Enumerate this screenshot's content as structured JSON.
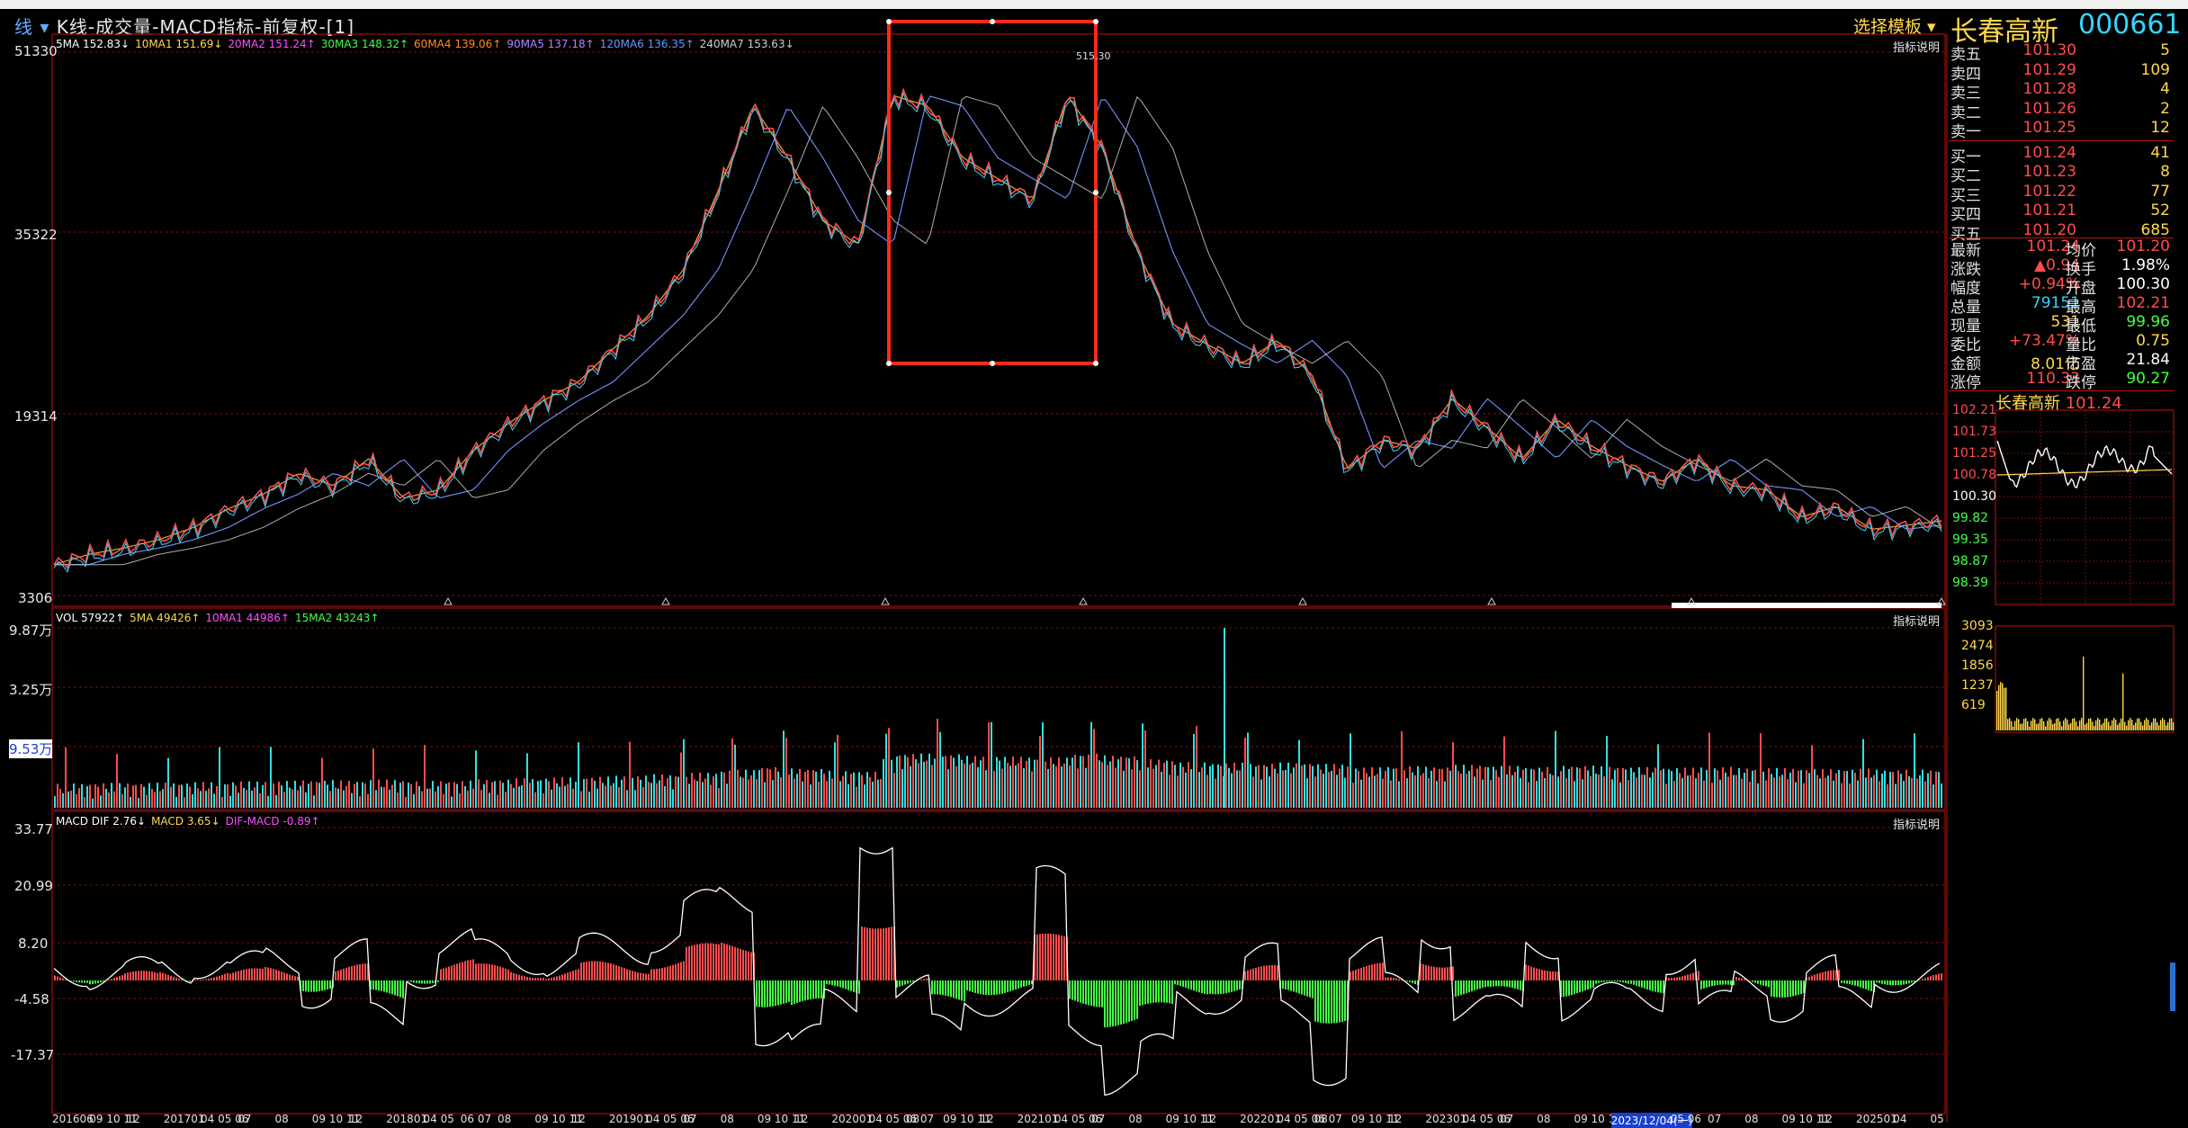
{
  "header": {
    "title_prefix": "线",
    "title": "K线-成交量-MACD指标-前复权-[1]",
    "template_button": "选择模板",
    "stock_name": "长春高新",
    "stock_code": "000661"
  },
  "ma_legend": [
    {
      "text": "5MA 152.83↓",
      "color": "#ffffff"
    },
    {
      "text": "10MA1 151.69↓",
      "color": "#ffd84a"
    },
    {
      "text": "20MA2 151.24↑",
      "color": "#ff4dff"
    },
    {
      "text": "30MA3 148.32↑",
      "color": "#44ff44"
    },
    {
      "text": "60MA4 139.06↑",
      "color": "#ff8c1a"
    },
    {
      "text": "90MA5 137.18↑",
      "color": "#aa88ff"
    },
    {
      "text": "120MA6 136.35↑",
      "color": "#6699ff"
    },
    {
      "text": "240MA7 153.63↓",
      "color": "#cccccc"
    }
  ],
  "vol_legend": [
    {
      "text": "VOL 57922↑",
      "color": "#ffffff"
    },
    {
      "text": "5MA 49426↑",
      "color": "#ffd84a"
    },
    {
      "text": "10MA1 44986↑",
      "color": "#ff4dff"
    },
    {
      "text": "15MA2 43243↑",
      "color": "#44ff44"
    }
  ],
  "macd_legend": [
    {
      "text": "MACD DIF 2.76↓",
      "color": "#ffffff"
    },
    {
      "text": "MACD 3.65↓",
      "color": "#ffd84a"
    },
    {
      "text": "DIF-MACD -0.89↑",
      "color": "#ff4dff"
    }
  ],
  "indicator_label": "指标说明",
  "peak_label": "515.30",
  "price_axis": [
    "51330",
    "35322",
    "19314",
    "3306"
  ],
  "vol_axis": [
    "9.87万",
    "3.25万",
    "9.53万"
  ],
  "macd_axis": [
    "33.77",
    "20.99",
    "8.20",
    "-4.58",
    "-17.37"
  ],
  "date_axis": [
    "201606",
    "09 10 11",
    "12",
    "201701",
    "04 05 06",
    "07",
    "08",
    "09 10 11",
    "12",
    "201801",
    "04 05",
    "06 07",
    "08",
    "09 10 11",
    "12",
    "201901",
    "04 05 06",
    "07",
    "08",
    "09 10 11",
    "12",
    "202001",
    "04 05 06 07",
    "08",
    "09 10 11",
    "12",
    "202101",
    "04 05 06",
    "07",
    "08",
    "09 10 11",
    "12",
    "202201",
    "04 05 06 07",
    "08",
    "09 10 11",
    "12",
    "202301",
    "04 05 06",
    "07",
    "08",
    "09 10 11"
  ],
  "date_cursor": "2023/12/04(一)",
  "date_axis_tail": [
    "05 06",
    "07",
    "08",
    "09 10 11",
    "12",
    "202501",
    "04",
    "05"
  ],
  "order_book": {
    "asks": [
      {
        "label": "卖五",
        "price": "101.30",
        "vol": "5"
      },
      {
        "label": "卖四",
        "price": "101.29",
        "vol": "109"
      },
      {
        "label": "卖三",
        "price": "101.28",
        "vol": "4"
      },
      {
        "label": "卖二",
        "price": "101.26",
        "vol": "2"
      },
      {
        "label": "卖一",
        "price": "101.25",
        "vol": "12"
      }
    ],
    "bids": [
      {
        "label": "买一",
        "price": "101.24",
        "vol": "41"
      },
      {
        "label": "买二",
        "price": "101.23",
        "vol": "8"
      },
      {
        "label": "买三",
        "price": "101.22",
        "vol": "77"
      },
      {
        "label": "买四",
        "price": "101.21",
        "vol": "52"
      },
      {
        "label": "买五",
        "price": "101.20",
        "vol": "685"
      }
    ]
  },
  "stats": [
    {
      "l1": "最新",
      "v1": "101.24",
      "c1": "#ff4d4d",
      "l2": "均价",
      "v2": "101.20",
      "c2": "#ff4d4d"
    },
    {
      "l1": "涨跌",
      "v1": "▲0.94",
      "c1": "#ff4d4d",
      "l2": "换手",
      "v2": "1.98%",
      "c2": "#ffffff"
    },
    {
      "l1": "幅度",
      "v1": "+0.94%",
      "c1": "#ff4d4d",
      "l2": "开盘",
      "v2": "100.30",
      "c2": "#ffffff"
    },
    {
      "l1": "总量",
      "v1": "79151",
      "c1": "#33d6ff",
      "l2": "最高",
      "v2": "102.21",
      "c2": "#ff4d4d"
    },
    {
      "l1": "现量",
      "v1": "531",
      "c1": "#ffd84a",
      "l2": "最低",
      "v2": "99.96",
      "c2": "#44ff44"
    },
    {
      "l1": "委比",
      "v1": "+73.47%",
      "c1": "#ff4d4d",
      "l2": "量比",
      "v2": "0.75",
      "c2": "#ffd84a"
    },
    {
      "l1": "金额",
      "v1": "8.01亿",
      "c1": "#ffd84a",
      "l2": "市盈",
      "v2": "21.84",
      "c2": "#ffffff"
    },
    {
      "l1": "涨停",
      "v1": "110.33",
      "c1": "#ff4d4d",
      "l2": "跌停",
      "v2": "90.27",
      "c2": "#44ff44"
    }
  ],
  "mini_chart": {
    "name": "长春高新",
    "last": "101.24",
    "price_labels": [
      {
        "t": "102.21",
        "c": "#ff4d4d"
      },
      {
        "t": "101.73",
        "c": "#ff4d4d"
      },
      {
        "t": "101.25",
        "c": "#ff4d4d"
      },
      {
        "t": "100.78",
        "c": "#ff4d4d"
      },
      {
        "t": "100.30",
        "c": "#ffffff"
      },
      {
        "t": "99.82",
        "c": "#44ff44"
      },
      {
        "t": "99.35",
        "c": "#44ff44"
      },
      {
        "t": "98.87",
        "c": "#44ff44"
      },
      {
        "t": "98.39",
        "c": "#44ff44"
      }
    ],
    "vol_labels": [
      "3093",
      "2474",
      "1856",
      "1237",
      "619"
    ]
  },
  "chart_data": {
    "type": "line",
    "description_series": "price close (前复权), monthly samples 2016-06 to 2025-05",
    "x": [
      "2016-06",
      "2016-09",
      "2016-12",
      "2017-03",
      "2017-06",
      "2017-09",
      "2017-12",
      "2018-03",
      "2018-06",
      "2018-09",
      "2018-12",
      "2019-01",
      "2019-03",
      "2019-06",
      "2019-09",
      "2019-12",
      "2020-01",
      "2020-03",
      "2020-06",
      "2020-07",
      "2020-08",
      "2020-09",
      "2020-10",
      "2020-12",
      "2021-01",
      "2021-02",
      "2021-03",
      "2021-04",
      "2021-05",
      "2021-06",
      "2021-07",
      "2021-08",
      "2021-09",
      "2021-10",
      "2021-12",
      "2022-01",
      "2022-03",
      "2022-04",
      "2022-05",
      "2022-06",
      "2022-08",
      "2022-10",
      "2022-12",
      "2023-01",
      "2023-03",
      "2023-06",
      "2023-09",
      "2023-12",
      "2024-03",
      "2024-06",
      "2024-09",
      "2024-10",
      "2024-12",
      "2025-02",
      "2025-05"
    ],
    "series": [
      {
        "values": [
          28,
          38,
          44,
          52,
          64,
          82,
          96,
          116,
          104,
          130,
          92,
          100,
          138,
          164,
          186,
          204,
          236,
          268,
          312,
          388,
          470,
          420,
          360,
          336,
          480,
          470,
          420,
          400,
          380,
          480,
          430,
          330,
          260,
          240,
          222,
          244,
          210,
          120,
          148,
          140,
          188,
          160,
          130,
          168,
          142,
          124,
          108,
          130,
          104,
          100,
          74,
          84,
          62,
          66,
          70
        ]
      }
    ],
    "ylim": [
      0,
      520
    ]
  }
}
